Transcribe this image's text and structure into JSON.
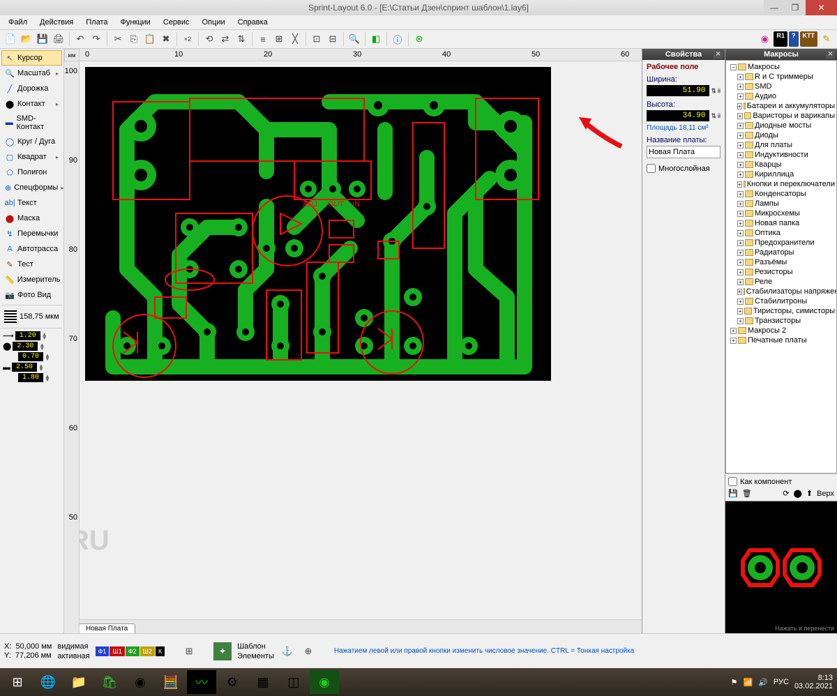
{
  "window": {
    "title": "Sprint-Layout 6.0 - [E:\\Статьи Дзен\\спринт шаблон\\1.lay6]",
    "min": "—",
    "max": "❐",
    "close": "✕"
  },
  "menu": [
    "Файл",
    "Действия",
    "Плата",
    "Функции",
    "Сервис",
    "Опции",
    "Справка"
  ],
  "tools": [
    {
      "icon": "↖",
      "label": "Курсор",
      "selected": true,
      "color": "#1060c0"
    },
    {
      "icon": "🔍",
      "label": "Масштаб",
      "caret": true,
      "color": "#1060c0"
    },
    {
      "icon": "╱",
      "label": "Дорожка",
      "color": "#1060c0"
    },
    {
      "icon": "⬤",
      "label": "Контакт",
      "caret": true,
      "color": "#000"
    },
    {
      "icon": "▬",
      "label": "SMD-Контакт",
      "color": "#0030a0"
    },
    {
      "icon": "◯",
      "label": "Круг / Дуга",
      "color": "#1060c0"
    },
    {
      "icon": "▢",
      "label": "Квадрат",
      "caret": true,
      "color": "#1060c0"
    },
    {
      "icon": "⬠",
      "label": "Полигон",
      "color": "#1060c0"
    },
    {
      "icon": "⊕",
      "label": "Спецформы",
      "caret": true,
      "color": "#1060c0"
    },
    {
      "icon": "ab|",
      "label": "Текст",
      "color": "#1060c0"
    },
    {
      "icon": "⬤",
      "label": "Маска",
      "color": "#c01010"
    },
    {
      "icon": "↯",
      "label": "Перемычки",
      "color": "#1060c0"
    },
    {
      "icon": "A",
      "label": "Автотрасса",
      "color": "#2080b0"
    },
    {
      "icon": "✎",
      "label": "Тест",
      "color": "#804020"
    },
    {
      "icon": "📏",
      "label": "Измеритель",
      "color": "#802020"
    },
    {
      "icon": "📷",
      "label": "Фото Вид",
      "color": "#406080"
    }
  ],
  "grid_value": "158,75 мкм",
  "params": [
    {
      "v": "1.20"
    },
    {
      "v": "2.30"
    },
    {
      "v": "0.70"
    },
    {
      "v": "2.50"
    },
    {
      "v": "1.80"
    }
  ],
  "ruler_unit": "мм",
  "ruler_h": [
    0,
    10,
    20,
    30,
    40,
    50,
    60
  ],
  "ruler_v": [
    100,
    90,
    80,
    70,
    60,
    50
  ],
  "properties": {
    "title": "Свойства",
    "section": "Рабочее поле",
    "width_label": "Ширина:",
    "width": "51.90",
    "height_label": "Высота:",
    "height": "34.90",
    "area": "Площадь 18,11 см²",
    "name_label": "Название платы:",
    "name": "Новая Плата",
    "multilayer": "Многослойная"
  },
  "macros": {
    "title": "Макросы",
    "root": "Макросы",
    "items": [
      "R и C триммеры",
      "SMD",
      "Аудио",
      "Батареи и аккумуляторы",
      "Варисторы и варикапы",
      "Диодные мосты",
      "Диоды",
      "Для платы",
      "Индуктивности",
      "Кварцы",
      "Кириллица",
      "Кнопки и переключатели",
      "Конденсаторы",
      "Лампы",
      "Микросхемы",
      "Новая папка",
      "Оптика",
      "Предохранители",
      "Радиаторы",
      "Разъёмы",
      "Резисторы",
      "Реле",
      "Стабилизаторы напряжения",
      "Стабилитроны",
      "Тиристоры, симисторы",
      "Транзисторы"
    ],
    "items2": [
      "Макросы 2",
      "Печатные платы"
    ],
    "as_component": "Как компонент",
    "up_label": "Верх",
    "hint": "Нажать и перенести"
  },
  "tab": "Новая Плата",
  "status": {
    "x_label": "X:",
    "x": "50,000 мм",
    "y_label": "Y:",
    "y": "77,206 мм",
    "visible": "видимая",
    "active": "активная",
    "layers": [
      {
        "t": "Ф1",
        "c": "#2040d0"
      },
      {
        "t": "Ш1",
        "c": "#c01010"
      },
      {
        "t": "Ф2",
        "c": "#20a020"
      },
      {
        "t": "Ш2",
        "c": "#c0a010"
      },
      {
        "t": "К",
        "c": "#000"
      }
    ],
    "template": "Шаблон",
    "elements": "Элементы",
    "hint": "Нажатием левой или правой кнопки изменить числовое значение. CTRL = Тонкая настройка"
  },
  "taskbar": {
    "lang": "РУС",
    "time": "8:13",
    "date": "03.02.2021"
  },
  "watermark": "RU"
}
